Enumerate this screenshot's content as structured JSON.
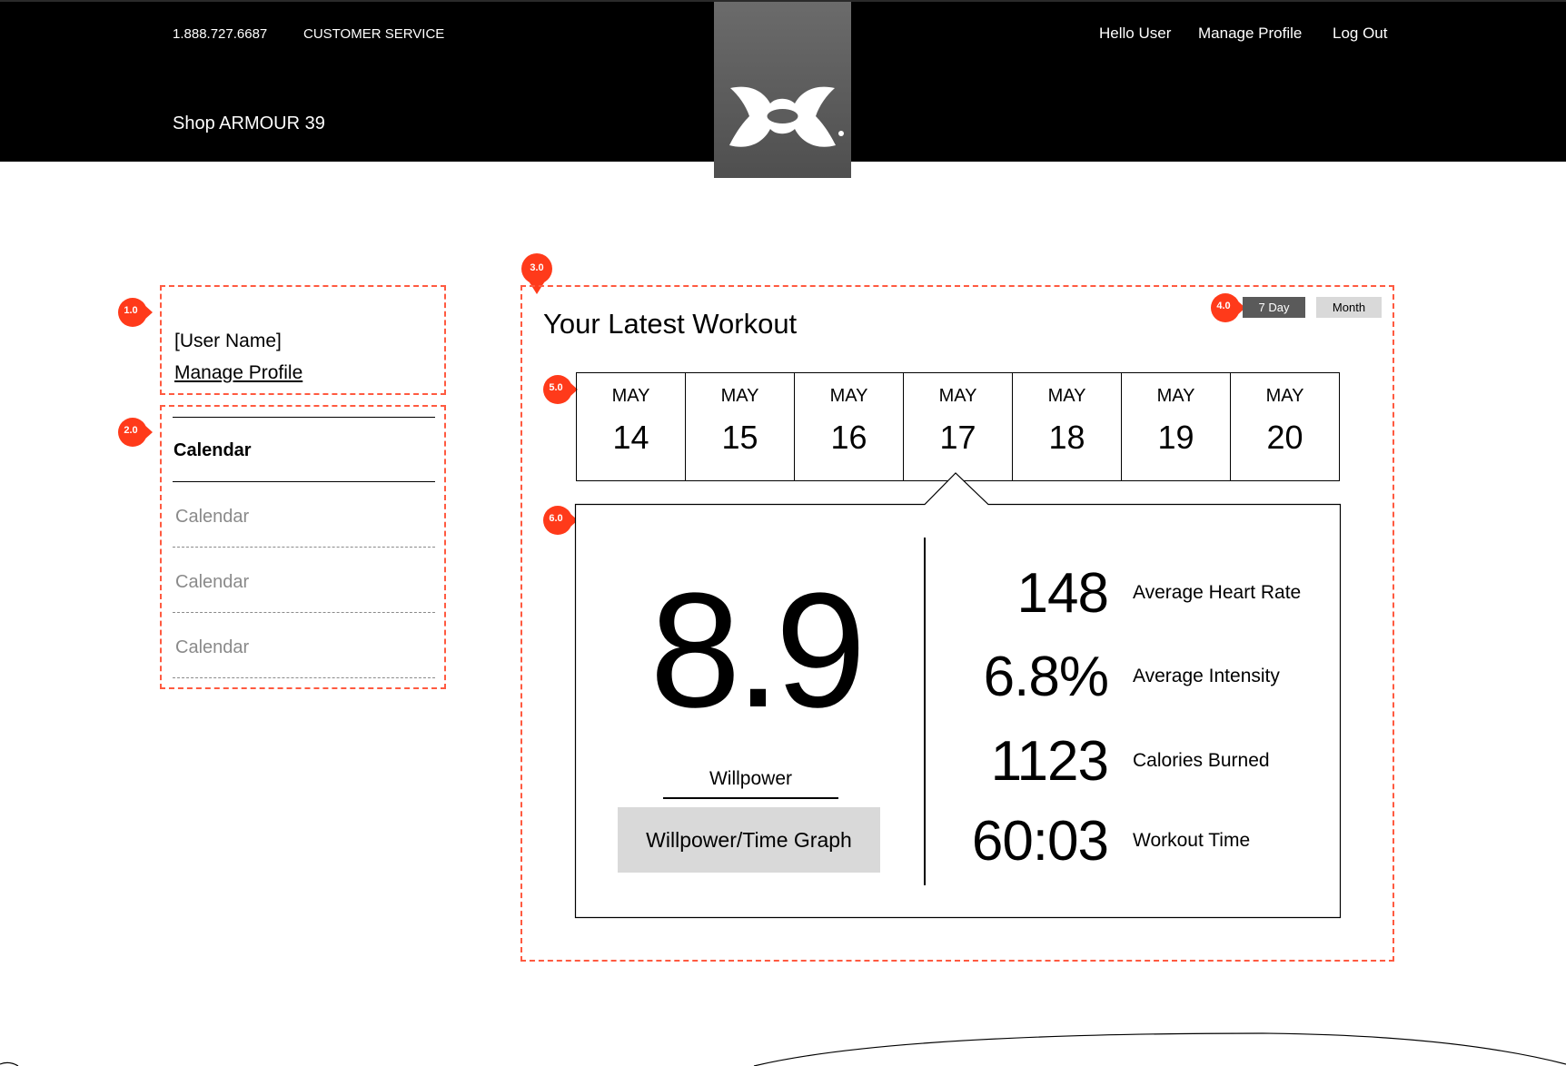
{
  "header": {
    "phone": "1.888.727.6687",
    "customer_service": "CUSTOMER SERVICE",
    "shop": "Shop ARMOUR 39",
    "greeting": "Hello User",
    "manage_profile": "Manage Profile",
    "logout": "Log Out"
  },
  "annotations": {
    "m1": "1.0",
    "m2": "2.0",
    "m3": "3.0",
    "m4": "4.0",
    "m5": "5.0",
    "m6": "6.0"
  },
  "profile": {
    "user_name": "[User Name]",
    "manage_profile": "Manage Profile"
  },
  "sidebar": {
    "items": [
      {
        "label": "Calendar",
        "active": true
      },
      {
        "label": "Calendar",
        "active": false
      },
      {
        "label": "Calendar",
        "active": false
      },
      {
        "label": "Calendar",
        "active": false
      }
    ]
  },
  "workout": {
    "title": "Your Latest Workout",
    "toggle": {
      "seven_day": "7 Day",
      "month": "Month",
      "selected": "7 Day"
    },
    "dates": [
      {
        "month": "MAY",
        "day": "14"
      },
      {
        "month": "MAY",
        "day": "15"
      },
      {
        "month": "MAY",
        "day": "16"
      },
      {
        "month": "MAY",
        "day": "17",
        "selected": true
      },
      {
        "month": "MAY",
        "day": "18"
      },
      {
        "month": "MAY",
        "day": "19"
      },
      {
        "month": "MAY",
        "day": "20"
      }
    ],
    "willpower": {
      "value": "8.9",
      "label": "Willpower",
      "graph_button": "Willpower/Time Graph"
    },
    "stats": [
      {
        "value": "148",
        "label": "Average Heart Rate"
      },
      {
        "value": "6.8%",
        "label": "Average Intensity"
      },
      {
        "value": "1123",
        "label": "Calories Burned"
      },
      {
        "value": "60:03",
        "label": "Workout Time"
      }
    ]
  },
  "colors": {
    "header_bg": "#000000",
    "annotation": "#ff3a1a",
    "dash": "#ff5a40",
    "toggle_active": "#5a5a5a",
    "toggle_inactive": "#d9d9d9",
    "graph_button_bg": "#d9d9d9"
  }
}
